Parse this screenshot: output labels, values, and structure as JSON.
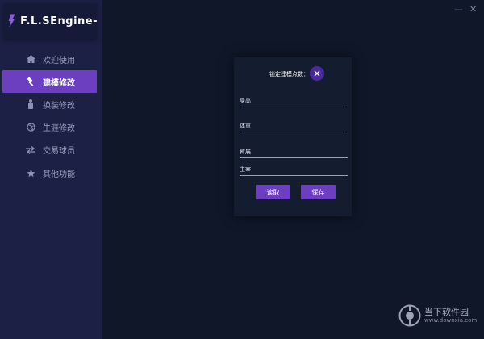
{
  "app": {
    "title": "F.L.SEngine-"
  },
  "sidebar": {
    "items": [
      {
        "label": "欢迎使用",
        "icon": "home-icon",
        "active": false
      },
      {
        "label": "建模修改",
        "icon": "hammer-icon",
        "active": true
      },
      {
        "label": "换装修改",
        "icon": "person-icon",
        "active": false
      },
      {
        "label": "生涯修改",
        "icon": "dribbble-ball-icon",
        "active": false
      },
      {
        "label": "交易球员",
        "icon": "exchange-icon",
        "active": false
      },
      {
        "label": "其他功能",
        "icon": "star-icon",
        "active": false
      }
    ]
  },
  "window": {
    "minimize": "—",
    "close": "✕"
  },
  "dialog": {
    "title": "锁定建模点数：",
    "fields": [
      {
        "label": "身高"
      },
      {
        "label": "体重"
      },
      {
        "label": "臂展"
      },
      {
        "label": "主宰"
      }
    ],
    "read_button": "读取",
    "save_button": "保存"
  },
  "watermark": {
    "name": "当下软件园",
    "url": "www.downxia.com"
  },
  "colors": {
    "accent": "#6b3fbf",
    "sidebar": "#1c2045",
    "background": "#0f1729",
    "dialog": "#141c30"
  }
}
